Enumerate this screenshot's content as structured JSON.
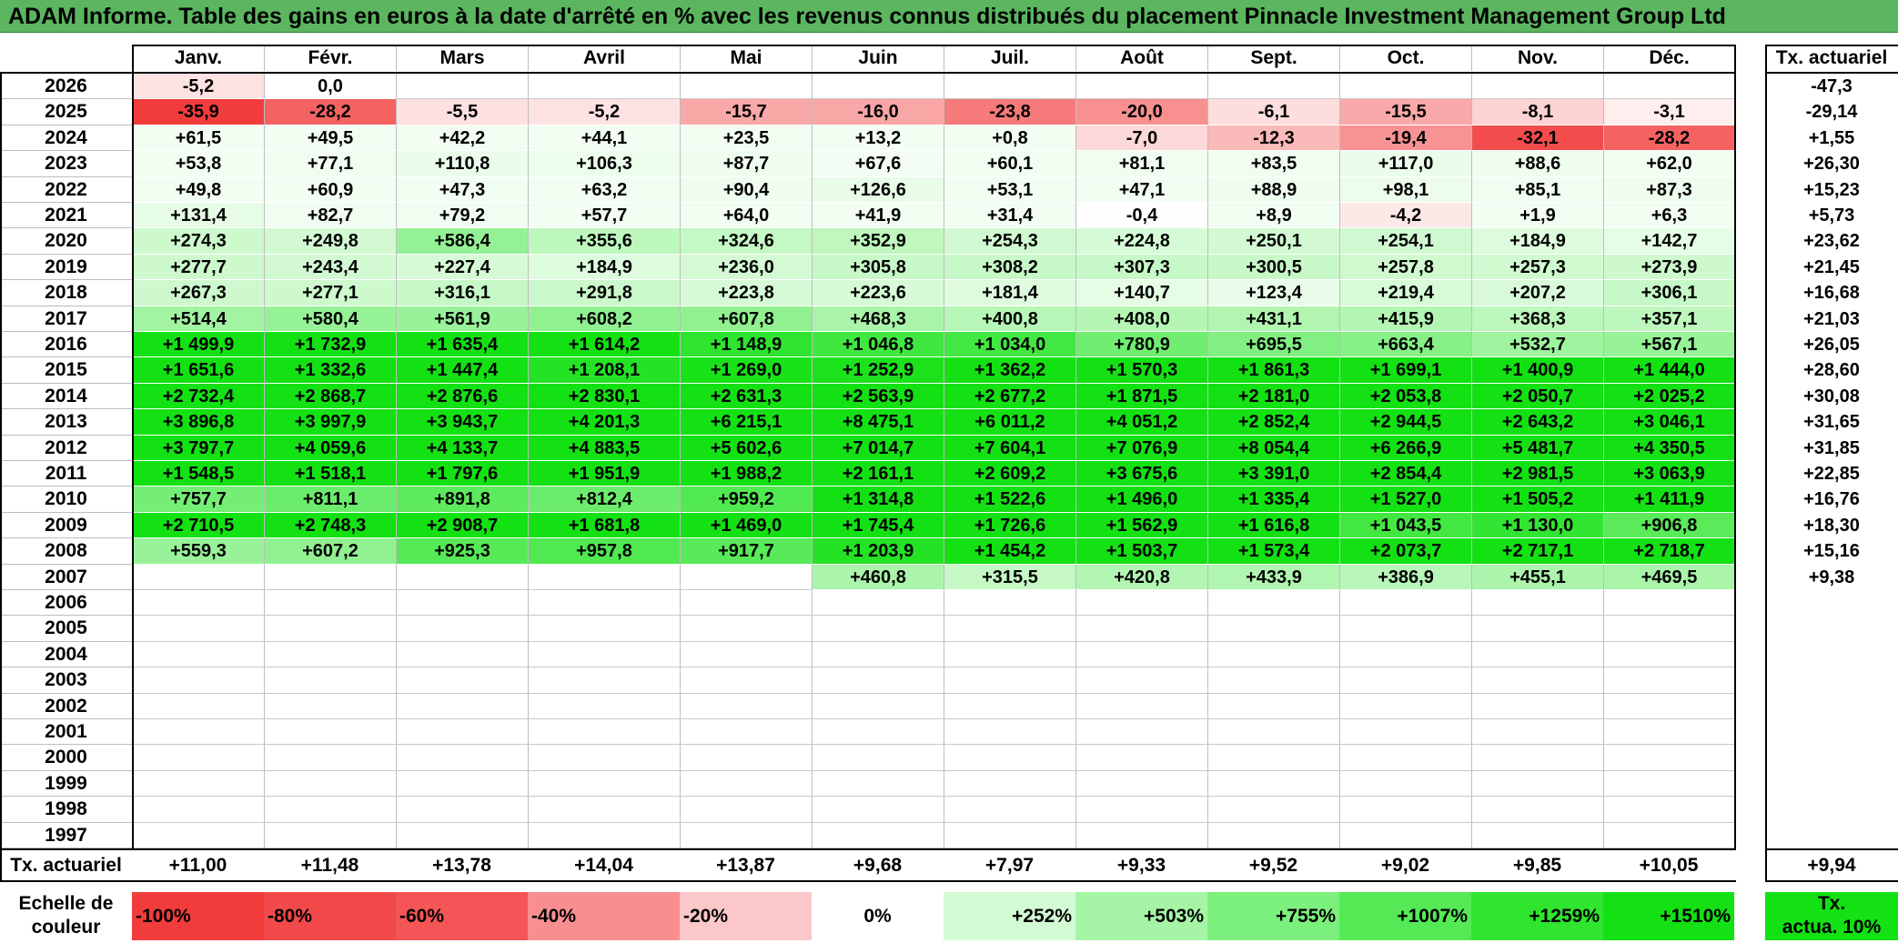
{
  "title": "ADAM Informe. Table des gains en euros à la date d'arrêté en % avec les revenus connus distribués du placement Pinnacle Investment Management Group Ltd",
  "months": [
    "Janv.",
    "Févr.",
    "Mars",
    "Avril",
    "Mai",
    "Juin",
    "Juil.",
    "Août",
    "Sept.",
    "Oct.",
    "Nov.",
    "Déc."
  ],
  "annual_header": "Tx. actuariel",
  "rows": [
    {
      "year": "2026",
      "cells": [
        "-5,2",
        "0,0",
        "",
        "",
        "",
        "",
        "",
        "",
        "",
        "",
        "",
        ""
      ],
      "annual": "-47,3"
    },
    {
      "year": "2025",
      "cells": [
        "-35,9",
        "-28,2",
        "-5,5",
        "-5,2",
        "-15,7",
        "-16,0",
        "-23,8",
        "-20,0",
        "-6,1",
        "-15,5",
        "-8,1",
        "-3,1"
      ],
      "annual": "-29,14"
    },
    {
      "year": "2024",
      "cells": [
        "+61,5",
        "+49,5",
        "+42,2",
        "+44,1",
        "+23,5",
        "+13,2",
        "+0,8",
        "-7,0",
        "-12,3",
        "-19,4",
        "-32,1",
        "-28,2"
      ],
      "annual": "+1,55"
    },
    {
      "year": "2023",
      "cells": [
        "+53,8",
        "+77,1",
        "+110,8",
        "+106,3",
        "+87,7",
        "+67,6",
        "+60,1",
        "+81,1",
        "+83,5",
        "+117,0",
        "+88,6",
        "+62,0"
      ],
      "annual": "+26,30"
    },
    {
      "year": "2022",
      "cells": [
        "+49,8",
        "+60,9",
        "+47,3",
        "+63,2",
        "+90,4",
        "+126,6",
        "+53,1",
        "+47,1",
        "+88,9",
        "+98,1",
        "+85,1",
        "+87,3"
      ],
      "annual": "+15,23"
    },
    {
      "year": "2021",
      "cells": [
        "+131,4",
        "+82,7",
        "+79,2",
        "+57,7",
        "+64,0",
        "+41,9",
        "+31,4",
        "-0,4",
        "+8,9",
        "-4,2",
        "+1,9",
        "+6,3"
      ],
      "annual": "+5,73"
    },
    {
      "year": "2020",
      "cells": [
        "+274,3",
        "+249,8",
        "+586,4",
        "+355,6",
        "+324,6",
        "+352,9",
        "+254,3",
        "+224,8",
        "+250,1",
        "+254,1",
        "+184,9",
        "+142,7"
      ],
      "annual": "+23,62"
    },
    {
      "year": "2019",
      "cells": [
        "+277,7",
        "+243,4",
        "+227,4",
        "+184,9",
        "+236,0",
        "+305,8",
        "+308,2",
        "+307,3",
        "+300,5",
        "+257,8",
        "+257,3",
        "+273,9"
      ],
      "annual": "+21,45"
    },
    {
      "year": "2018",
      "cells": [
        "+267,3",
        "+277,1",
        "+316,1",
        "+291,8",
        "+223,8",
        "+223,6",
        "+181,4",
        "+140,7",
        "+123,4",
        "+219,4",
        "+207,2",
        "+306,1"
      ],
      "annual": "+16,68"
    },
    {
      "year": "2017",
      "cells": [
        "+514,4",
        "+580,4",
        "+561,9",
        "+608,2",
        "+607,8",
        "+468,3",
        "+400,8",
        "+408,0",
        "+431,1",
        "+415,9",
        "+368,3",
        "+357,1"
      ],
      "annual": "+21,03"
    },
    {
      "year": "2016",
      "cells": [
        "+1 499,9",
        "+1 732,9",
        "+1 635,4",
        "+1 614,2",
        "+1 148,9",
        "+1 046,8",
        "+1 034,0",
        "+780,9",
        "+695,5",
        "+663,4",
        "+532,7",
        "+567,1"
      ],
      "annual": "+26,05"
    },
    {
      "year": "2015",
      "cells": [
        "+1 651,6",
        "+1 332,6",
        "+1 447,4",
        "+1 208,1",
        "+1 269,0",
        "+1 252,9",
        "+1 362,2",
        "+1 570,3",
        "+1 861,3",
        "+1 699,1",
        "+1 400,9",
        "+1 444,0"
      ],
      "annual": "+28,60"
    },
    {
      "year": "2014",
      "cells": [
        "+2 732,4",
        "+2 868,7",
        "+2 876,6",
        "+2 830,1",
        "+2 631,3",
        "+2 563,9",
        "+2 677,2",
        "+1 871,5",
        "+2 181,0",
        "+2 053,8",
        "+2 050,7",
        "+2 025,2"
      ],
      "annual": "+30,08"
    },
    {
      "year": "2013",
      "cells": [
        "+3 896,8",
        "+3 997,9",
        "+3 943,7",
        "+4 201,3",
        "+6 215,1",
        "+8 475,1",
        "+6 011,2",
        "+4 051,2",
        "+2 852,4",
        "+2 944,5",
        "+2 643,2",
        "+3 046,1"
      ],
      "annual": "+31,65"
    },
    {
      "year": "2012",
      "cells": [
        "+3 797,7",
        "+4 059,6",
        "+4 133,7",
        "+4 883,5",
        "+5 602,6",
        "+7 014,7",
        "+7 604,1",
        "+7 076,9",
        "+8 054,4",
        "+6 266,9",
        "+5 481,7",
        "+4 350,5"
      ],
      "annual": "+31,85"
    },
    {
      "year": "2011",
      "cells": [
        "+1 548,5",
        "+1 518,1",
        "+1 797,6",
        "+1 951,9",
        "+1 988,2",
        "+2 161,1",
        "+2 609,2",
        "+3 675,6",
        "+3 391,0",
        "+2 854,4",
        "+2 981,5",
        "+3 063,9"
      ],
      "annual": "+22,85"
    },
    {
      "year": "2010",
      "cells": [
        "+757,7",
        "+811,1",
        "+891,8",
        "+812,4",
        "+959,2",
        "+1 314,8",
        "+1 522,6",
        "+1 496,0",
        "+1 335,4",
        "+1 527,0",
        "+1 505,2",
        "+1 411,9"
      ],
      "annual": "+16,76"
    },
    {
      "year": "2009",
      "cells": [
        "+2 710,5",
        "+2 748,3",
        "+2 908,7",
        "+1 681,8",
        "+1 469,0",
        "+1 745,4",
        "+1 726,6",
        "+1 562,9",
        "+1 616,8",
        "+1 043,5",
        "+1 130,0",
        "+906,8"
      ],
      "annual": "+18,30"
    },
    {
      "year": "2008",
      "cells": [
        "+559,3",
        "+607,2",
        "+925,3",
        "+957,8",
        "+917,7",
        "+1 203,9",
        "+1 454,2",
        "+1 503,7",
        "+1 573,4",
        "+2 073,7",
        "+2 717,1",
        "+2 718,7"
      ],
      "annual": "+15,16"
    },
    {
      "year": "2007",
      "cells": [
        "",
        "",
        "",
        "",
        "",
        "+460,8",
        "+315,5",
        "+420,8",
        "+433,9",
        "+386,9",
        "+455,1",
        "+469,5"
      ],
      "annual": "+9,38"
    },
    {
      "year": "2006",
      "cells": [
        "",
        "",
        "",
        "",
        "",
        "",
        "",
        "",
        "",
        "",
        "",
        ""
      ],
      "annual": ""
    },
    {
      "year": "2005",
      "cells": [
        "",
        "",
        "",
        "",
        "",
        "",
        "",
        "",
        "",
        "",
        "",
        ""
      ],
      "annual": ""
    },
    {
      "year": "2004",
      "cells": [
        "",
        "",
        "",
        "",
        "",
        "",
        "",
        "",
        "",
        "",
        "",
        ""
      ],
      "annual": ""
    },
    {
      "year": "2003",
      "cells": [
        "",
        "",
        "",
        "",
        "",
        "",
        "",
        "",
        "",
        "",
        "",
        ""
      ],
      "annual": ""
    },
    {
      "year": "2002",
      "cells": [
        "",
        "",
        "",
        "",
        "",
        "",
        "",
        "",
        "",
        "",
        "",
        ""
      ],
      "annual": ""
    },
    {
      "year": "2001",
      "cells": [
        "",
        "",
        "",
        "",
        "",
        "",
        "",
        "",
        "",
        "",
        "",
        ""
      ],
      "annual": ""
    },
    {
      "year": "2000",
      "cells": [
        "",
        "",
        "",
        "",
        "",
        "",
        "",
        "",
        "",
        "",
        "",
        ""
      ],
      "annual": ""
    },
    {
      "year": "1999",
      "cells": [
        "",
        "",
        "",
        "",
        "",
        "",
        "",
        "",
        "",
        "",
        "",
        ""
      ],
      "annual": ""
    },
    {
      "year": "1998",
      "cells": [
        "",
        "",
        "",
        "",
        "",
        "",
        "",
        "",
        "",
        "",
        "",
        ""
      ],
      "annual": ""
    },
    {
      "year": "1997",
      "cells": [
        "",
        "",
        "",
        "",
        "",
        "",
        "",
        "",
        "",
        "",
        "",
        ""
      ],
      "annual": ""
    }
  ],
  "summary": {
    "label": "Tx. actuariel",
    "cells": [
      "+11,00",
      "+11,48",
      "+13,78",
      "+14,04",
      "+13,87",
      "+9,68",
      "+7,97",
      "+9,33",
      "+9,52",
      "+9,02",
      "+9,85",
      "+10,05"
    ],
    "annual": "+9,94"
  },
  "scale": {
    "label_line1": "Echelle de",
    "label_line2": "couleur",
    "steps": [
      {
        "text": "-100%",
        "color": "#f23c3c",
        "align": "left"
      },
      {
        "text": "-80%",
        "color": "#f3494b",
        "align": "left"
      },
      {
        "text": "-60%",
        "color": "#f55556",
        "align": "left"
      },
      {
        "text": "-40%",
        "color": "#f88e90",
        "align": "left"
      },
      {
        "text": "-20%",
        "color": "#fbc7c8",
        "align": "left"
      },
      {
        "text": "0%",
        "color": "#ffffff",
        "align": "center"
      },
      {
        "text": "+252%",
        "color": "#d3fbd3",
        "align": "right"
      },
      {
        "text": "+503%",
        "color": "#a6f5a6",
        "align": "right"
      },
      {
        "text": "+755%",
        "color": "#7cf07c",
        "align": "right"
      },
      {
        "text": "+1007%",
        "color": "#55ea55",
        "align": "right"
      },
      {
        "text": "+1259%",
        "color": "#2fe52f",
        "align": "right"
      },
      {
        "text": "+1510%",
        "color": "#13e113",
        "align": "right"
      }
    ],
    "annual_line1": "Tx.",
    "annual_line2": "actua. 10%",
    "annual_color": "#13e113"
  },
  "colors": {
    "title_bg": "#5bb65f",
    "neg_max": "#f23c3c",
    "neutral": "#ffffff",
    "pos_max": "#13e113"
  }
}
